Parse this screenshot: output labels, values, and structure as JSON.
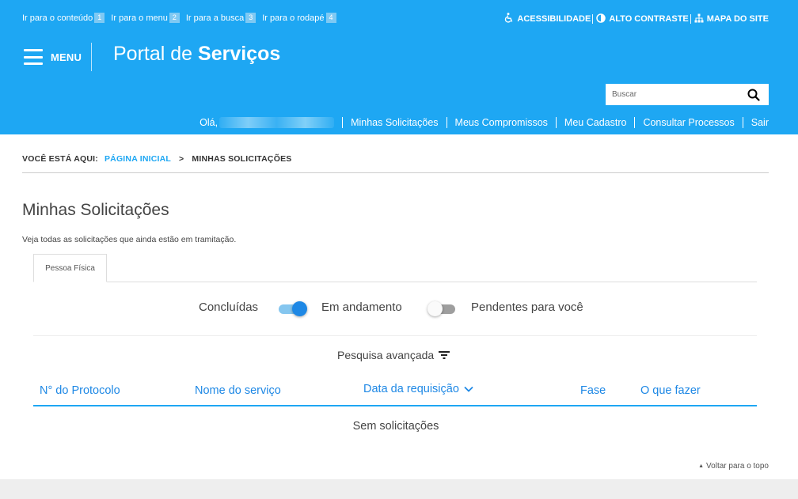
{
  "skiplinks": [
    {
      "label": "Ir para o conteúdo",
      "num": "1"
    },
    {
      "label": "Ir para o menu",
      "num": "2"
    },
    {
      "label": "Ir para a busca",
      "num": "3"
    },
    {
      "label": "Ir para o rodapé",
      "num": "4"
    }
  ],
  "toplinks": {
    "accessibility": "ACESSIBILIDADE",
    "contrast": "ALTO CONTRASTE",
    "sitemap": "MAPA DO SITE"
  },
  "header": {
    "menu_label": "MENU",
    "title_prefix": "Portal de ",
    "title_bold": "Serviços"
  },
  "search": {
    "placeholder": "Buscar",
    "value": ""
  },
  "usernav": {
    "greeting": "Olá,",
    "items": [
      "Minhas Solicitações",
      "Meus Compromissos",
      "Meu Cadastro",
      "Consultar Processos",
      "Sair"
    ]
  },
  "breadcrumb": {
    "label": "VOCÊ ESTÁ AQUI:",
    "home": "PÁGINA INICIAL",
    "arrow": ">",
    "current": "MINHAS SOLICITAÇÕES"
  },
  "main": {
    "title": "Minhas Solicitações",
    "description": "Veja todas as solicitações que ainda estão em tramitação.",
    "tab": "Pessoa Física"
  },
  "filters": {
    "concluidas": "Concluídas",
    "em_andamento": "Em andamento",
    "pendentes": "Pendentes para você",
    "toggle1_on": true,
    "toggle2_on": false
  },
  "advanced_search": "Pesquisa avançada",
  "table": {
    "columns": [
      "N° do Protocolo",
      "Nome do serviço",
      "Data da requisição",
      "Fase",
      "O que fazer"
    ],
    "empty": "Sem solicitações"
  },
  "back_to_top": "Voltar para o topo",
  "colors": {
    "header_bg": "#1ea7f3",
    "accent": "#1e88e5",
    "toggle_on": "#1e88e5"
  }
}
